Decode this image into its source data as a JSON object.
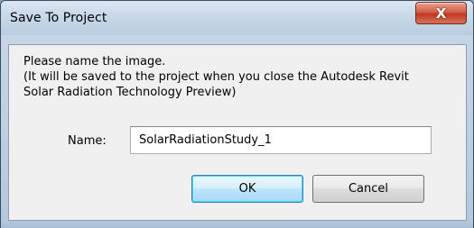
{
  "window": {
    "title": "Save To Project",
    "close_icon": "close-icon",
    "close_glyph": "X"
  },
  "message": {
    "line1": "Please name the image.",
    "line2": "(It will be saved to the project when you close the Autodesk Revit",
    "line3": "Solar Radiation Technology Preview)"
  },
  "form": {
    "name_label": "Name:",
    "name_value": "SolarRadiationStudy_1"
  },
  "buttons": {
    "ok_label": "OK",
    "cancel_label": "Cancel"
  },
  "colors": {
    "titlebar": "#c6d7e8",
    "close_button": "#c0391f",
    "client_background": "#f0f0f0",
    "default_button_border": "#3c7fb1"
  }
}
